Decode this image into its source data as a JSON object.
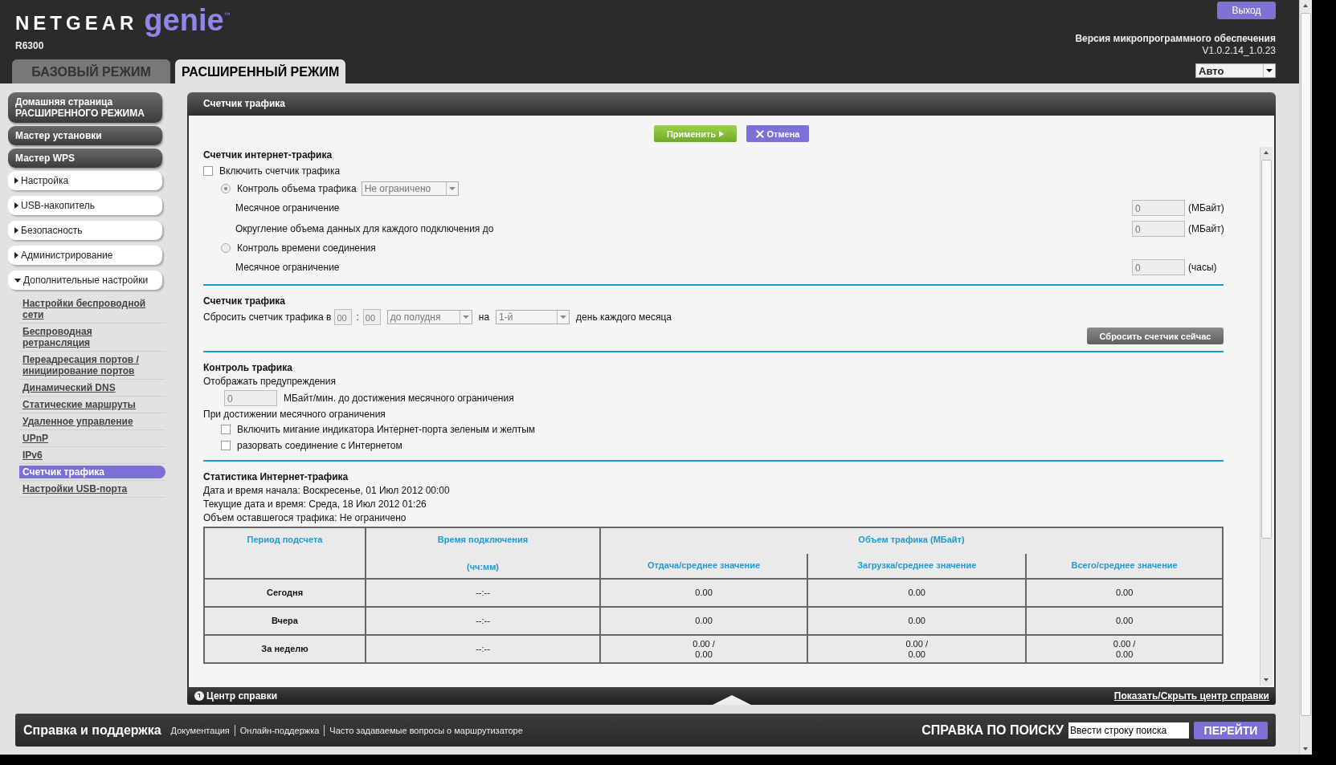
{
  "header": {
    "brand": "NETGEAR",
    "product": "genie",
    "trademark": "™",
    "model": "R6300",
    "logout": "Выход",
    "firmware_label": "Версия микропрограммного обеспечения",
    "firmware_version": "V1.0.2.14_1.0.23",
    "language": "Авто"
  },
  "mode_tabs": [
    {
      "label": "БАЗОВЫЙ РЕЖИМ",
      "selected": false
    },
    {
      "label": "РАСШИРЕННЫЙ РЕЖИМ",
      "selected": true
    }
  ],
  "sidebar": [
    {
      "kind": "button",
      "label": "Домашняя страница РАСШИРЕННОГО РЕЖИМА"
    },
    {
      "kind": "button",
      "label": "Мастер установки"
    },
    {
      "kind": "button",
      "label": "Мастер WPS"
    },
    {
      "kind": "group",
      "label": "Настройка",
      "expanded": false
    },
    {
      "kind": "group",
      "label": "USB-накопитель",
      "expanded": false
    },
    {
      "kind": "group",
      "label": "Безопасность",
      "expanded": false
    },
    {
      "kind": "group",
      "label": "Администрирование",
      "expanded": false
    },
    {
      "kind": "group",
      "label": "Дополнительные настройки",
      "expanded": true,
      "children": [
        {
          "label": "Настройки беспроводной сети",
          "selected": false
        },
        {
          "label": "Беспроводная ретрансляция",
          "selected": false
        },
        {
          "label": "Переадресация портов / инициирование портов",
          "selected": false
        },
        {
          "label": "Динамический DNS",
          "selected": false
        },
        {
          "label": "Статические маршруты",
          "selected": false
        },
        {
          "label": "Удаленное управление",
          "selected": false
        },
        {
          "label": "UPnP",
          "selected": false
        },
        {
          "label": "IPv6",
          "selected": false
        },
        {
          "label": "Счетчик трафика",
          "selected": true
        },
        {
          "label": "Настройки USB-порта",
          "selected": false
        }
      ]
    }
  ],
  "panel": {
    "title": "Счетчик трафика",
    "buttons": [
      {
        "kind": "apply",
        "label": "Применить"
      },
      {
        "kind": "cancel",
        "label": "Отмена"
      }
    ],
    "internet_counter": {
      "title": "Счетчик интернет-трафика",
      "enable": {
        "label": "Включить счетчик трафика",
        "checked": false
      },
      "options": [
        {
          "label": "Контроль объема трафика",
          "selected": true,
          "select": "Не ограничено",
          "fields": [
            {
              "label": "Месячное ограничение",
              "value": "0",
              "unit": "(МБайт)"
            },
            {
              "label": "Округление объема данных для каждого подключения до",
              "value": "0",
              "unit": "(МБайт)"
            }
          ]
        },
        {
          "label": "Контроль времени соединения",
          "selected": false,
          "fields": [
            {
              "label": "Месячное ограничение",
              "value": "0",
              "unit": "(часы)"
            }
          ]
        }
      ]
    },
    "counter": {
      "title": "Счетчик трафика",
      "reset_label": "Сбросить счетчик трафика в",
      "hour": "00",
      "separator": ":",
      "minute": "00",
      "period": "до полудня",
      "on_label": "на",
      "day": "1-й",
      "day_suffix": "день каждого месяца",
      "reset_now": "Сбросить счетчик сейчас"
    },
    "control": {
      "title": "Контроль трафика",
      "warn_label": "Отображать предупреждения",
      "warn_value": "0",
      "warn_suffix": "МБайт/мин. до достижения месячного ограничения",
      "limit_label": "При достижении месячного ограничения",
      "actions": [
        {
          "label": "Включить мигание индикатора Интернет-порта зеленым и желтым",
          "checked": false
        },
        {
          "label": "разорвать соединение с Интернетом",
          "checked": false
        }
      ]
    },
    "stats": {
      "title": "Статистика Интернет-трафика",
      "lines": [
        "Дата и время начала: Воскресенье, 01 Июл 2012 00:00",
        "Текущие дата и время: Среда, 18 Июл 2012 01:26",
        "Объем оставшегося трафика: Не ограничено"
      ],
      "table": {
        "col_period": "Период подсчета",
        "col_time": "Время подключения",
        "col_time_unit": "(чч:мм)",
        "col_group": "Объем трафика (МБайт)",
        "sub_columns": [
          "Отдача/среднее значение",
          "Загрузка/среднее значение",
          "Всего/среднее значение"
        ],
        "rows": [
          {
            "period": "Сегодня",
            "time": "--:--",
            "values": [
              [
                "0.00"
              ],
              [
                "0.00"
              ],
              [
                "0.00"
              ]
            ]
          },
          {
            "period": "Вчера",
            "time": "--:--",
            "values": [
              [
                "0.00"
              ],
              [
                "0.00"
              ],
              [
                "0.00"
              ]
            ]
          },
          {
            "period": "За неделю",
            "time": "--:--",
            "values": [
              [
                "0.00 /",
                "0.00"
              ],
              [
                "0.00 /",
                "0.00"
              ],
              [
                "0.00 /",
                "0.00"
              ]
            ]
          }
        ]
      }
    }
  },
  "help_bar": {
    "label": "Центр справки",
    "toggle": "Показать/Скрыть центр справки"
  },
  "footer": {
    "title": "Справка и поддержка",
    "links": [
      "Документация",
      "Онлайн-поддержка",
      "Часто задаваемые вопросы о маршрутизаторе"
    ],
    "search_label": "СПРАВКА ПО ПОИСКУ",
    "search_value": "Ввести строку поиска",
    "go": "ПЕРЕЙТИ"
  }
}
